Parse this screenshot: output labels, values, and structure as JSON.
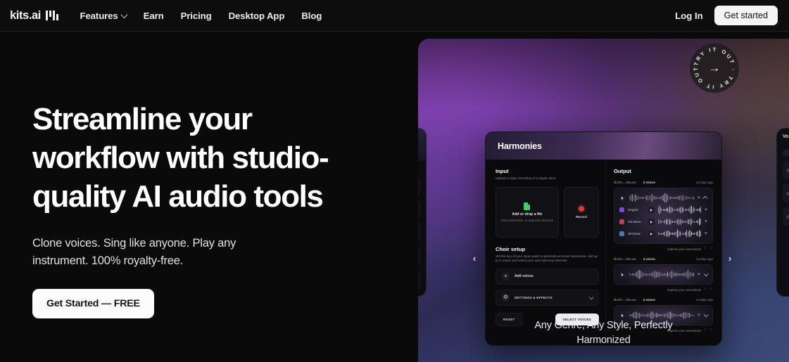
{
  "nav": {
    "brand": {
      "word": "kits.ai",
      "mark_icon": "kits-logo-mark-icon"
    },
    "links": [
      {
        "label": "Features",
        "has_caret": true
      },
      {
        "label": "Earn",
        "has_caret": false
      },
      {
        "label": "Pricing",
        "has_caret": false
      },
      {
        "label": "Desktop App",
        "has_caret": false
      },
      {
        "label": "Blog",
        "has_caret": false
      }
    ],
    "login_label": "Log In",
    "get_started_label": "Get started"
  },
  "hero": {
    "headline": "Streamline your workflow with studio-quality AI audio tools",
    "subtext": "Clone voices. Sing like anyone. Play any instrument.  100% royalty-free.",
    "cta_label": "Get Started — FREE",
    "caption": "Any Genre, Any Style, Perfectly Harmonized",
    "caption_line1": "Any Genre, Any Style, Perfectly",
    "caption_line2": "Harmonized",
    "badge_text": "TRY IT OUT · TRY IT OUT · ",
    "badge_arrow": "→",
    "prev_arrow": "‹",
    "next_arrow": "›"
  },
  "app_card": {
    "title": "Harmonies",
    "input": {
      "section_title": "Input",
      "section_desc": "Upload a clean recording of a single voice.",
      "dropzone_title": "Add or drop a file",
      "dropzone_sub": "Click and browse, or drag and drop here",
      "record_label": "Record"
    },
    "choir": {
      "section_title": "Choir setup",
      "section_desc": "Set the key of your input audio to generate accurate harmonies. Add up to 4 voices and select your own harmony intervals.",
      "add_voices_label": "Add voices",
      "settings_label": "SETTINGS & EFFECTS",
      "reset_label": "RESET",
      "select_voices_label": "SELECT VOICES"
    },
    "output": {
      "section_title": "Output",
      "improve_label": "Improve your conversions",
      "items": [
        {
          "name": "tlbcths...olla.wav",
          "separator": "›",
          "count": "3 voices",
          "time": "14 days ago",
          "voices": [
            {
              "label": "Original",
              "color": "#7b4ad0"
            },
            {
              "label": "3rd above",
              "color": "#b9425a"
            },
            {
              "label": "4th below",
              "color": "#3f7fb5"
            }
          ]
        },
        {
          "name": "tlbcths...olla.wav",
          "separator": "›",
          "count": "3 voices",
          "time": "14 days ago"
        },
        {
          "name": "tlbcths...olla.wav",
          "separator": "›",
          "count": "3 voices",
          "time": "14 days ago"
        }
      ]
    }
  },
  "side_cards": {
    "right_title": "Vo"
  },
  "colors": {
    "page_bg": "#0a0a0a",
    "nav_bg": "#0d0d0d",
    "accent_purple": "#7b48b0",
    "accent_blue": "#3c4a78",
    "cta_bg": "#fbfbfb",
    "record_red": "#d93a3a",
    "file_green": "#3ccf6e"
  }
}
